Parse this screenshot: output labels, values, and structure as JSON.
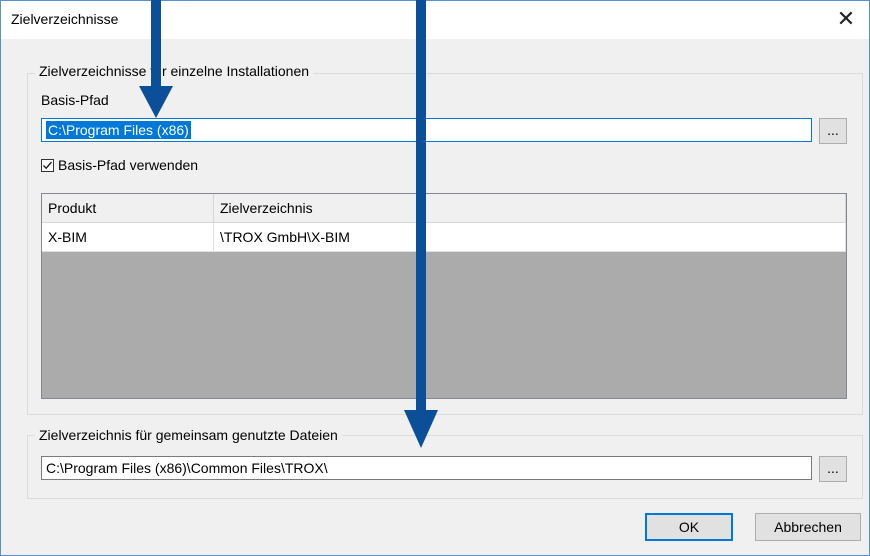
{
  "window": {
    "title": "Zielverzeichnisse",
    "close_glyph": "✕"
  },
  "group_individual": {
    "legend": "Zielverzeichnisse für einzelne Installationen",
    "base_path_label": "Basis-Pfad",
    "base_path_value": "C:\\Program Files (x86)",
    "browse_label": "...",
    "use_base_path_label": "Basis-Pfad verwenden",
    "use_base_path_checked": true,
    "table": {
      "columns": [
        "Produkt",
        "Zielverzeichnis"
      ],
      "rows": [
        [
          "X-BIM",
          "\\TROX GmbH\\X-BIM"
        ]
      ]
    }
  },
  "group_shared": {
    "legend": "Zielverzeichnis für gemeinsam genutzte Dateien",
    "path_value": "C:\\Program Files (x86)\\Common Files\\TROX\\",
    "browse_label": "..."
  },
  "buttons": {
    "ok": "OK",
    "cancel": "Abbrechen"
  },
  "colors": {
    "annotation_arrow": "#0b4f99",
    "accent": "#0078d7"
  }
}
